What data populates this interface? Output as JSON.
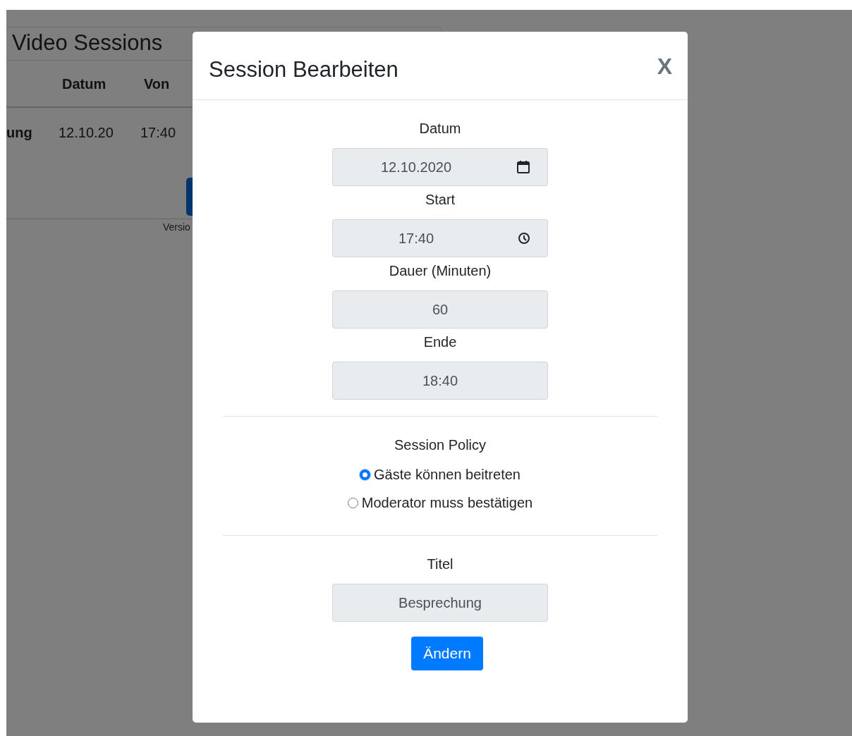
{
  "background": {
    "title": "Video Sessions",
    "columns": [
      "Datum",
      "Von"
    ],
    "row": [
      "ung",
      "12.10.20",
      "17:40"
    ],
    "footer": "Versio"
  },
  "modal": {
    "title": "Session Bearbeiten",
    "close": "X",
    "fields": [
      {
        "label": "Datum",
        "value": "12.10.2020",
        "kind": "date"
      },
      {
        "label": "Start",
        "value": "17:40",
        "kind": "time"
      },
      {
        "label": "Dauer (Minuten)",
        "value": "60",
        "kind": "number"
      },
      {
        "label": "Ende",
        "value": "18:40",
        "kind": "text"
      }
    ],
    "policy": {
      "label": "Session Policy",
      "options": [
        {
          "label": "Gäste können beitreten",
          "selected": true
        },
        {
          "label": "Moderator muss bestätigen",
          "selected": false
        }
      ]
    },
    "title_field": {
      "label": "Titel",
      "value": "Besprechung"
    },
    "submit": "Ändern"
  }
}
